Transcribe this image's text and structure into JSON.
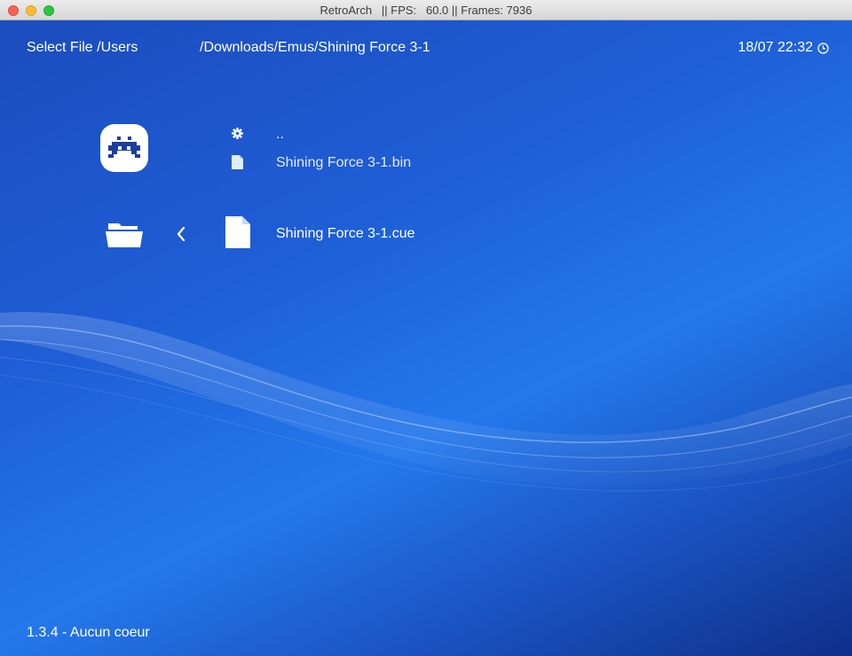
{
  "window": {
    "title": "RetroArch   || FPS:   60.0 || Frames: 7936"
  },
  "header": {
    "title": "Select File /Users",
    "path": "/Downloads/Emus/Shining Force 3-1",
    "clock": "18/07 22:32"
  },
  "file_list": {
    "entries": [
      {
        "label": "..",
        "icon": "gear-icon"
      },
      {
        "label": "Shining Force 3-1.bin",
        "icon": "file-icon"
      },
      {
        "label": "Shining Force 3-1.cue",
        "icon": "file-icon",
        "selected": true
      }
    ]
  },
  "sidebar": {
    "icons": [
      "retroarch-logo",
      "folder-icon",
      "chevron-left-icon"
    ]
  },
  "footer": {
    "version": "1.3.4 - Aucun coeur"
  }
}
